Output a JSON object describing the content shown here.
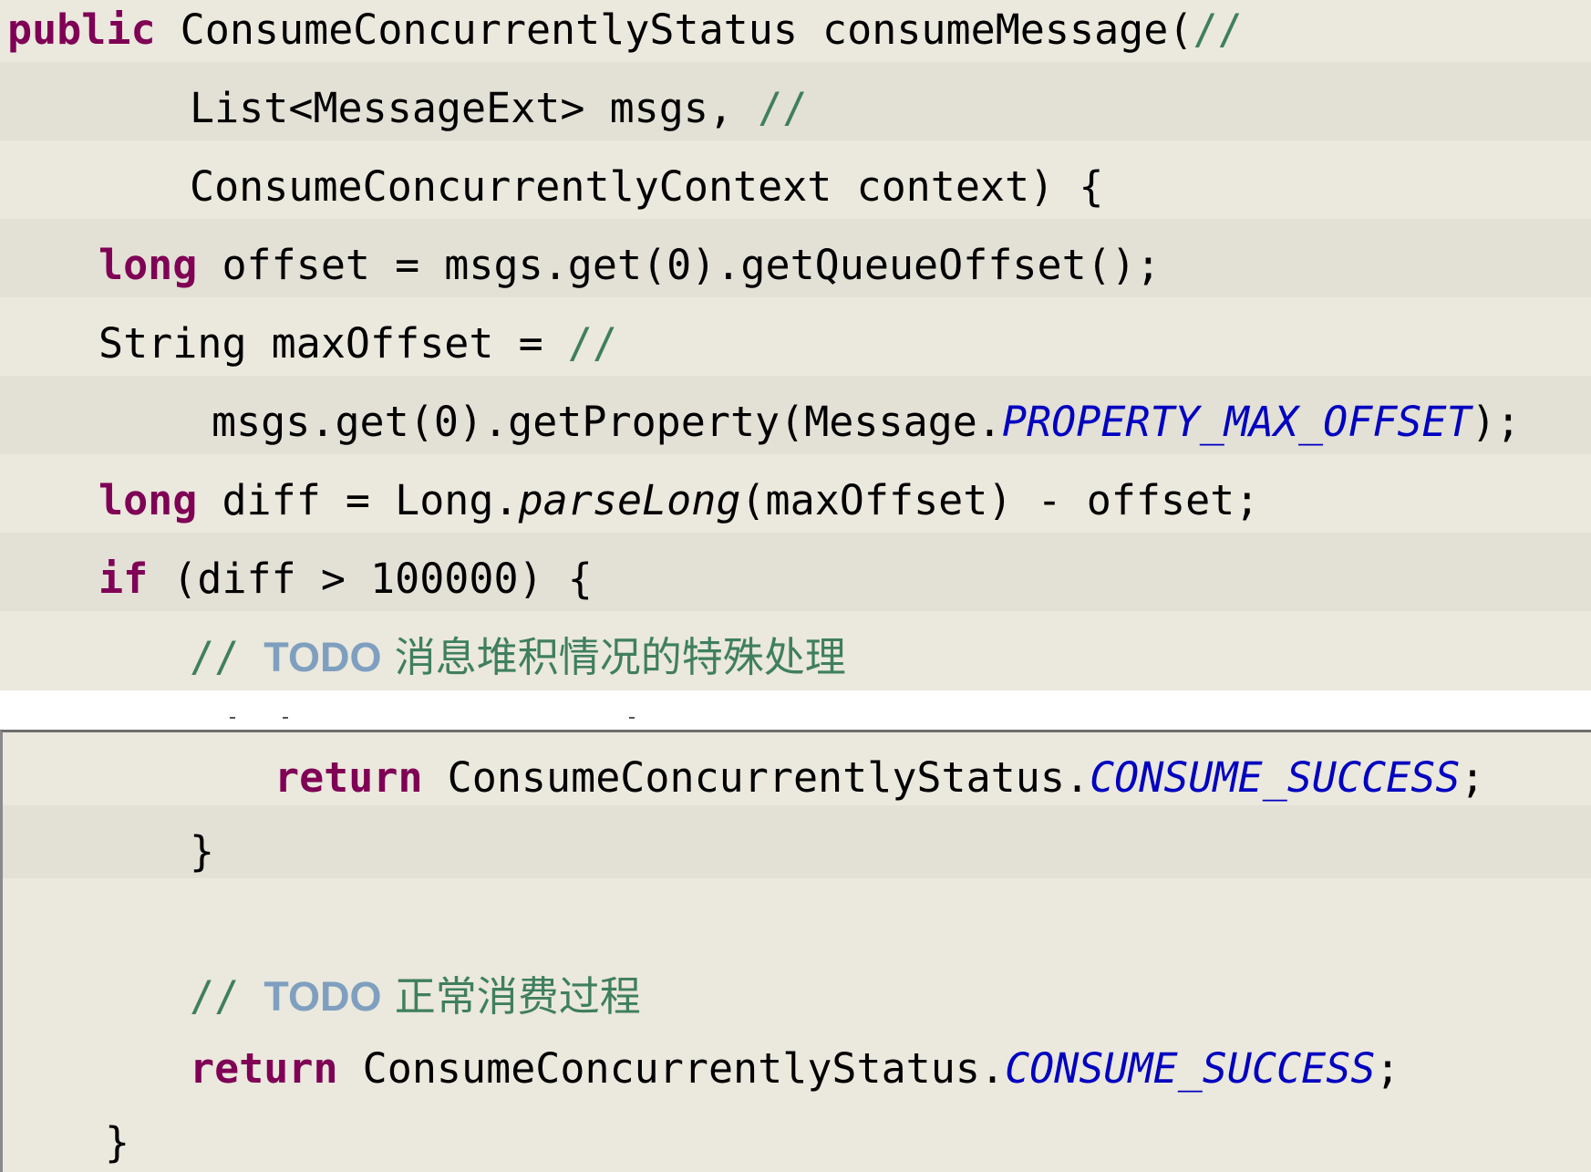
{
  "top_panel": {
    "lines": [
      {
        "t1": "public",
        "t2": " ConsumeConcurrentlyStatus consumeMessage(",
        "t3": "//"
      },
      {
        "t1": "List<MessageExt> msgs, ",
        "t2": "//"
      },
      {
        "t1": "ConsumeConcurrentlyContext context) {"
      },
      {
        "t1": "long",
        "t2": " offset = msgs.get(0).getQueueOffset();"
      },
      {
        "t1": "String maxOffset = ",
        "t2": "//"
      },
      {
        "t1": "msgs.get(0).getProperty(Message.",
        "t2": "PROPERTY_MAX_OFFSET",
        "t3": ");"
      },
      {
        "t1": "long",
        "t2": " diff = Long.",
        "t3": "parseLong",
        "t4": "(maxOffset) - offset;"
      },
      {
        "t1": "if",
        "t2": " (diff > 100000) {"
      },
      {
        "t1": "// ",
        "t2": "TODO",
        "t3": " 消息堆积情况的特殊处理"
      }
    ]
  },
  "bottom_panel": {
    "lines": [
      {
        "t1": "return",
        "t2": " ConsumeConcurrentlyStatus.",
        "t3": "CONSUME_SUCCESS",
        "t4": ";"
      },
      {
        "t1": "}"
      },
      {
        "t1": "// ",
        "t2": "TODO",
        "t3": " 正常消费过程"
      },
      {
        "t1": "return",
        "t2": " ConsumeConcurrentlyStatus.",
        "t3": "CONSUME_SUCCESS",
        "t4": ";"
      },
      {
        "t1": "}"
      }
    ]
  },
  "colors": {
    "keyword": "#7f0055",
    "comment": "#3f7f5f",
    "todo_tag": "#7f9fbf",
    "static_field": "#0000c0",
    "background": "#ebe8dd"
  }
}
